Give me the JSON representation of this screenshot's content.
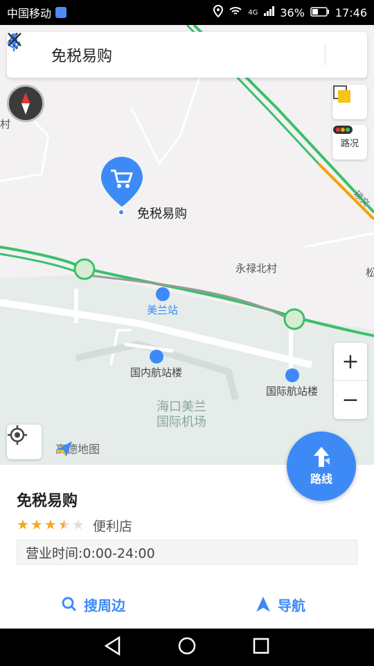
{
  "status_bar": {
    "carrier": "中国移动",
    "network": "4G",
    "battery": "36%",
    "time": "17:46"
  },
  "search": {
    "query": "免税易购"
  },
  "map": {
    "poi_label": "免税易购",
    "labels": {
      "station": "美兰站",
      "village": "永禄北村",
      "domestic_terminal": "国内航站楼",
      "intl_terminal": "国际航站楼",
      "airport_line1": "海口美兰",
      "airport_line2": "国际机场",
      "left_edge": "村",
      "right_edge": "松",
      "road": "琼文"
    },
    "buttons": {
      "traffic": "路况",
      "zoom_in": "+",
      "zoom_out": "−"
    },
    "logo": "高德地图"
  },
  "route_button": {
    "label": "路线"
  },
  "poi": {
    "title": "免税易购",
    "rating": 3.5,
    "category": "便利店",
    "hours": "营业时间:0:00-24:00"
  },
  "actions": {
    "nearby": "搜周边",
    "navigate": "导航"
  },
  "colors": {
    "accent": "#3d8af7",
    "star": "#f5a623",
    "road_green": "#3bbf6b",
    "road_orange": "#f2a300"
  },
  "icons": {
    "back": "arrow-left-icon",
    "mic": "microphone-icon",
    "close": "close-icon",
    "compass": "compass-icon",
    "layers": "layers-icon",
    "traffic": "traffic-light-icon",
    "locate": "locate-icon",
    "poi_marker": "shopping-cart-marker-icon",
    "nearby": "search-icon",
    "navigate": "navigate-arrow-icon"
  }
}
